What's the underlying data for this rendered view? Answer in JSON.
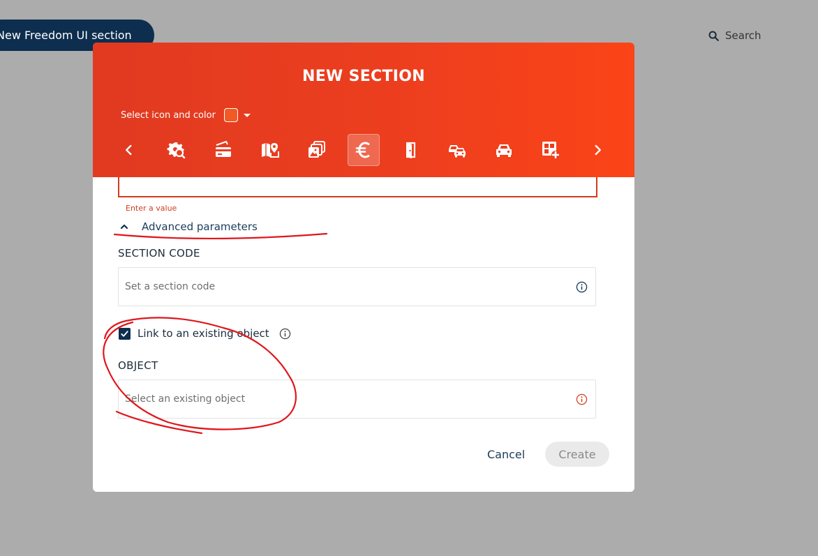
{
  "background": {
    "section_button_label": "New Freedom UI section",
    "search_label": "Search"
  },
  "dialog": {
    "title": "NEW SECTION",
    "icon_color_label": "Select icon and color",
    "selected_color": "#f15a24",
    "icons": [
      "gear-search-icon",
      "card-icon",
      "map-pin-icon",
      "photos-icon",
      "euro-icon",
      "door-icon",
      "cars-icon",
      "car-icon",
      "grid-add-icon"
    ],
    "selected_icon": "euro-icon",
    "name_error": "Enter a value",
    "advanced_label": "Advanced parameters",
    "section_code": {
      "label": "SECTION CODE",
      "placeholder": "Set a section code"
    },
    "link_existing": {
      "label": "Link to an existing object",
      "checked": true
    },
    "object": {
      "label": "OBJECT",
      "placeholder": "Select an existing object"
    },
    "cancel_label": "Cancel",
    "create_label": "Create"
  },
  "colors": {
    "accent": "#ec3e1f",
    "navy": "#0d2e4e",
    "error": "#d23b1c"
  }
}
